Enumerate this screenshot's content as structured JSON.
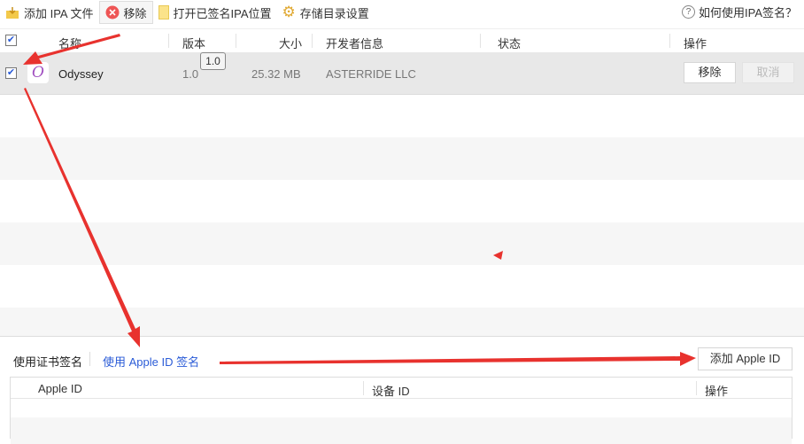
{
  "toolbar": {
    "add_ipa": "添加 IPA 文件",
    "remove": "移除",
    "open_signed": "打开已签名IPA位置",
    "storage_settings": "存储目录设置",
    "help": "如何使用IPA签名？"
  },
  "table": {
    "headers": {
      "name": "名称",
      "version": "版本",
      "size": "大小",
      "developer": "开发者信息",
      "status": "状态",
      "action": "操作"
    },
    "rows": [
      {
        "name": "Odyssey",
        "version": "1.0",
        "size": "25.32 MB",
        "developer": "ASTERRIDE LLC",
        "status": "",
        "remove": "移除",
        "cancel": "取消",
        "tooltip": "1.0"
      }
    ]
  },
  "bottom": {
    "tab_cert": "使用证书签名",
    "tab_appleid": "使用 Apple ID 签名",
    "add_appleid": "添加 Apple ID",
    "headers": {
      "apple_id": "Apple ID",
      "device_id": "设备 ID",
      "action": "操作"
    }
  },
  "colors": {
    "link": "#2a5bd7",
    "arrow": "#e8322e"
  }
}
